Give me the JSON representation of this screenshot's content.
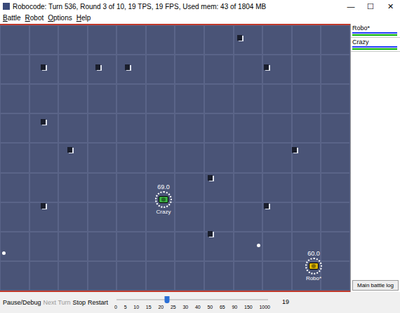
{
  "window": {
    "title": "Robocode: Turn 536, Round 3 of 10, 19 TPS, 19 FPS, Used mem: 43 of 1804 MB",
    "controls": [
      "—",
      "☐",
      "✕"
    ]
  },
  "menu": [
    "Battle",
    "Robot",
    "Options",
    "Help"
  ],
  "robots": [
    {
      "name": "Crazy",
      "energy": "69.0",
      "color": "#3cb043"
    },
    {
      "name": "Robo*",
      "energy": "60.0",
      "color": "#d9b300"
    }
  ],
  "scoreboard": [
    {
      "name": "Robo*",
      "energy_level": 0.97,
      "gun_level": 0.97
    },
    {
      "name": "Crazy",
      "energy_level": 0.97,
      "gun_level": 0.97
    }
  ],
  "log_button": "Main battle log",
  "buttons": [
    {
      "label": "Pause/Debug",
      "disabled": false
    },
    {
      "label": "Next Turn",
      "disabled": true
    },
    {
      "label": "Stop",
      "disabled": false
    },
    {
      "label": "Restart",
      "disabled": false
    }
  ],
  "speed": {
    "ticks": [
      "0",
      "5",
      "10",
      "15",
      "20",
      "25",
      "30",
      "40",
      "50",
      "65",
      "90",
      "150",
      "1000"
    ],
    "level": 0.333,
    "reading": "19"
  }
}
